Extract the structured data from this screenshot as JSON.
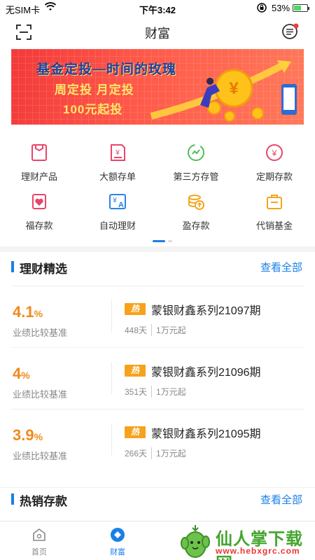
{
  "status_bar": {
    "carrier": "无SIM卡",
    "time": "下午3:42",
    "battery_pct": "53%",
    "battery_level": 0.53
  },
  "header": {
    "title": "财富",
    "scan_icon": "scan-icon",
    "message_icon": "message-icon"
  },
  "banner": {
    "line1": "基金定投—时间的玫瑰",
    "line2": "周定投 月定投",
    "line3": "100元起投"
  },
  "menu": {
    "items": [
      {
        "label": "理财产品",
        "icon": "wealth-product-icon",
        "color": "#e8456b"
      },
      {
        "label": "大额存单",
        "icon": "large-deposit-icon",
        "color": "#e8456b"
      },
      {
        "label": "第三方存管",
        "icon": "custody-icon",
        "color": "#4cbf5b"
      },
      {
        "label": "定期存款",
        "icon": "fixed-deposit-icon",
        "color": "#e8456b"
      },
      {
        "label": "福存款",
        "icon": "fu-deposit-icon",
        "color": "#e8456b"
      },
      {
        "label": "自动理财",
        "icon": "auto-finance-icon",
        "color": "#2a83e6"
      },
      {
        "label": "盈存款",
        "icon": "ying-deposit-icon",
        "color": "#f2a61b"
      },
      {
        "label": "代销基金",
        "icon": "agency-fund-icon",
        "color": "#f2a61b"
      }
    ]
  },
  "featured": {
    "title": "理财精选",
    "more": "查看全部",
    "products": [
      {
        "rate": "4.1",
        "unit": "%",
        "bench": "业绩比较基准",
        "hot": "热",
        "name": "蒙银财鑫系列21097期",
        "days": "448天",
        "min": "1万元起"
      },
      {
        "rate": "4",
        "unit": "%",
        "bench": "业绩比较基准",
        "hot": "热",
        "name": "蒙银财鑫系列21096期",
        "days": "351天",
        "min": "1万元起"
      },
      {
        "rate": "3.9",
        "unit": "%",
        "bench": "业绩比较基准",
        "hot": "热",
        "name": "蒙银财鑫系列21095期",
        "days": "266天",
        "min": "1万元起"
      }
    ]
  },
  "hot_deposits": {
    "title": "热销存款",
    "more": "查看全部"
  },
  "tabbar": {
    "tabs": [
      {
        "label": "首页",
        "icon": "home-icon"
      },
      {
        "label": "财富",
        "icon": "wealth-icon"
      }
    ]
  },
  "watermark": {
    "brand": "仙人掌下载网",
    "url": "www.hebxgrc.com"
  },
  "colors": {
    "accent": "#1a7fe6",
    "rate": "#f08a19",
    "hot_badge": "#f6a21c"
  }
}
